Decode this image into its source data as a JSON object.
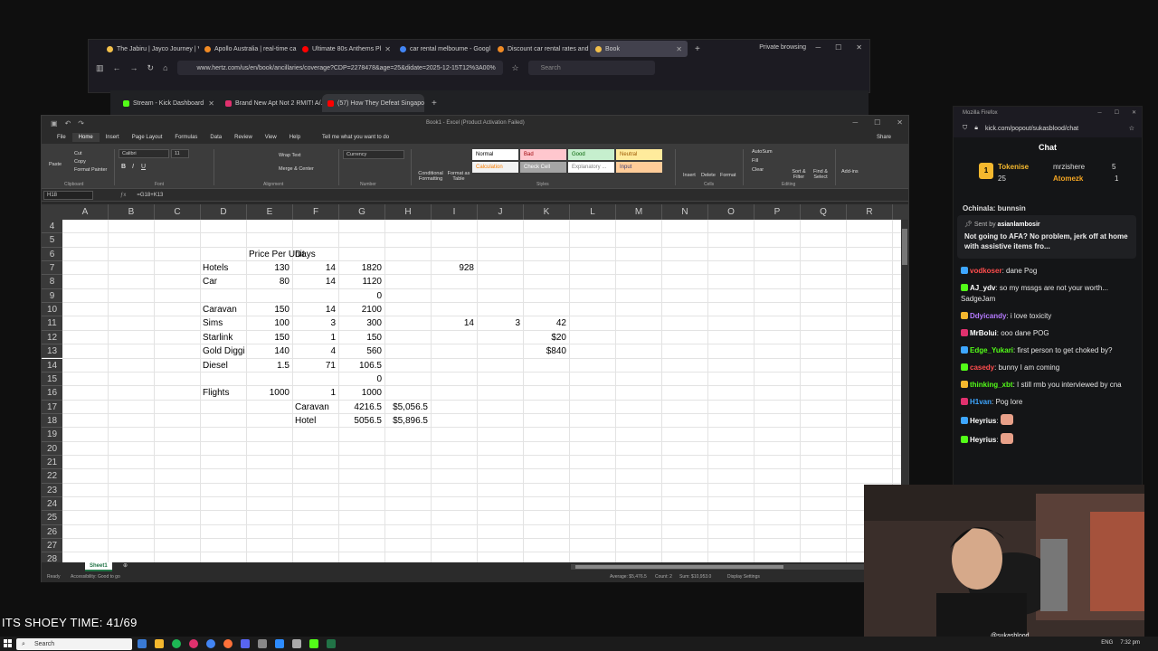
{
  "browser_back": {
    "tabs": [
      {
        "label": "The Jabiru | Jayco Journey | V",
        "color": "#f3c04a"
      },
      {
        "label": "Apollo Australia | real-time ca",
        "color": "#f08a24"
      },
      {
        "label": "Ultimate 80s Anthems Pl",
        "color": "#ff0000"
      },
      {
        "label": "car rental melbourne - Googl",
        "color": "#4285f4"
      },
      {
        "label": "Discount car rental rates and",
        "color": "#f08a24"
      },
      {
        "label": "Book",
        "color": "#f3c04a",
        "active": true
      }
    ],
    "private_label": "Private browsing",
    "url": "www.hertz.com/us/en/book/ancillaries/coverage?CDP=2278478&age=25&didate=2025-12-15T12%3A00%",
    "search_placeholder": "Search"
  },
  "browser_mid": {
    "tabs": [
      {
        "label": "Stream - Kick Dashboard",
        "color": "#53fc18"
      },
      {
        "label": "Brand New Apt Not 2 RMIT! A/...",
        "color": "#e0316e"
      },
      {
        "label": "(57) How They Defeat Singapo",
        "color": "#ff0000",
        "active": true
      }
    ]
  },
  "excel": {
    "title": "Book1 - Excel (Product Activation Failed)",
    "menu": [
      "File",
      "Home",
      "Insert",
      "Page Layout",
      "Formulas",
      "Data",
      "Review",
      "View",
      "Help"
    ],
    "tell_me": "Tell me what you want to do",
    "share": "Share",
    "ribbon": {
      "paste": "Paste",
      "cut": "Cut",
      "copy": "Copy",
      "format_painter": "Format Painter",
      "clipboard": "Clipboard",
      "font_name": "Calibri",
      "font_size": "11",
      "font": "Font",
      "wrap_text": "Wrap Text",
      "merge_center": "Merge & Center",
      "alignment": "Alignment",
      "number_format": "Currency",
      "number": "Number",
      "conditional": "Conditional Formatting",
      "format_as_table": "Format as Table",
      "styles": [
        {
          "label": "Normal",
          "bg": "#ffffff",
          "fg": "#000000"
        },
        {
          "label": "Bad",
          "bg": "#ffc7ce",
          "fg": "#9c0006"
        },
        {
          "label": "Good",
          "bg": "#c6efce",
          "fg": "#006100"
        },
        {
          "label": "Neutral",
          "bg": "#ffeb9c",
          "fg": "#9c5700"
        },
        {
          "label": "Calculation",
          "bg": "#f2f2f2",
          "fg": "#fa7d00"
        },
        {
          "label": "Check Cell",
          "bg": "#a5a5a5",
          "fg": "#ffffff"
        },
        {
          "label": "Explanatory ...",
          "bg": "#ffffff",
          "fg": "#7f7f7f"
        },
        {
          "label": "Input",
          "bg": "#ffcc99",
          "fg": "#3f3f76"
        }
      ],
      "styles_label": "Styles",
      "insert": "Insert",
      "delete": "Delete",
      "format": "Format",
      "cells": "Cells",
      "autosum": "AutoSum",
      "fill": "Fill",
      "clear": "Clear",
      "sort_filter": "Sort & Filter",
      "find_select": "Find & Select",
      "editing": "Editing",
      "addins": "Add-ins"
    },
    "name_box": "H18",
    "formula": "=G18+K13",
    "columns": [
      "A",
      "B",
      "C",
      "D",
      "E",
      "F",
      "G",
      "H",
      "I",
      "J",
      "K",
      "L",
      "M",
      "N",
      "O",
      "P",
      "Q",
      "R"
    ],
    "rows": [
      "4",
      "5",
      "6",
      "7",
      "8",
      "9",
      "10",
      "11",
      "12",
      "13",
      "14",
      "15",
      "16",
      "17",
      "18",
      "19",
      "20",
      "21",
      "22",
      "23",
      "24",
      "25",
      "26",
      "27",
      "28"
    ],
    "cells": [
      {
        "row": "6",
        "col": "E",
        "text": "Price Per Unit",
        "align": "left"
      },
      {
        "row": "6",
        "col": "F",
        "text": "Days",
        "align": "left"
      },
      {
        "row": "7",
        "col": "D",
        "text": "Hotels",
        "align": "left"
      },
      {
        "row": "7",
        "col": "E",
        "text": "130",
        "align": "right"
      },
      {
        "row": "7",
        "col": "F",
        "text": "14",
        "align": "right"
      },
      {
        "row": "7",
        "col": "G",
        "text": "1820",
        "align": "right"
      },
      {
        "row": "7",
        "col": "I",
        "text": "928",
        "align": "right"
      },
      {
        "row": "8",
        "col": "D",
        "text": "Car",
        "align": "left"
      },
      {
        "row": "8",
        "col": "E",
        "text": "80",
        "align": "right"
      },
      {
        "row": "8",
        "col": "F",
        "text": "14",
        "align": "right"
      },
      {
        "row": "8",
        "col": "G",
        "text": "1120",
        "align": "right"
      },
      {
        "row": "9",
        "col": "G",
        "text": "0",
        "align": "right"
      },
      {
        "row": "10",
        "col": "D",
        "text": "Caravan",
        "align": "left"
      },
      {
        "row": "10",
        "col": "E",
        "text": "150",
        "align": "right"
      },
      {
        "row": "10",
        "col": "F",
        "text": "14",
        "align": "right"
      },
      {
        "row": "10",
        "col": "G",
        "text": "2100",
        "align": "right"
      },
      {
        "row": "11",
        "col": "D",
        "text": "Sims",
        "align": "left"
      },
      {
        "row": "11",
        "col": "E",
        "text": "100",
        "align": "right"
      },
      {
        "row": "11",
        "col": "F",
        "text": "3",
        "align": "right"
      },
      {
        "row": "11",
        "col": "G",
        "text": "300",
        "align": "right"
      },
      {
        "row": "11",
        "col": "I",
        "text": "14",
        "align": "right"
      },
      {
        "row": "11",
        "col": "J",
        "text": "3",
        "align": "right"
      },
      {
        "row": "11",
        "col": "K",
        "text": "42",
        "align": "right"
      },
      {
        "row": "12",
        "col": "D",
        "text": "Starlink",
        "align": "left"
      },
      {
        "row": "12",
        "col": "E",
        "text": "150",
        "align": "right"
      },
      {
        "row": "12",
        "col": "F",
        "text": "1",
        "align": "right"
      },
      {
        "row": "12",
        "col": "G",
        "text": "150",
        "align": "right"
      },
      {
        "row": "12",
        "col": "K",
        "text": "$20",
        "align": "right"
      },
      {
        "row": "13",
        "col": "D",
        "text": "Gold Diggi",
        "align": "left"
      },
      {
        "row": "13",
        "col": "E",
        "text": "140",
        "align": "right"
      },
      {
        "row": "13",
        "col": "F",
        "text": "4",
        "align": "right"
      },
      {
        "row": "13",
        "col": "G",
        "text": "560",
        "align": "right"
      },
      {
        "row": "13",
        "col": "K",
        "text": "$840",
        "align": "right"
      },
      {
        "row": "14",
        "col": "D",
        "text": "Diesel",
        "align": "left"
      },
      {
        "row": "14",
        "col": "E",
        "text": "1.5",
        "align": "right"
      },
      {
        "row": "14",
        "col": "F",
        "text": "71",
        "align": "right"
      },
      {
        "row": "14",
        "col": "G",
        "text": "106.5",
        "align": "right"
      },
      {
        "row": "15",
        "col": "G",
        "text": "0",
        "align": "right"
      },
      {
        "row": "16",
        "col": "D",
        "text": "Flights",
        "align": "left"
      },
      {
        "row": "16",
        "col": "E",
        "text": "1000",
        "align": "right"
      },
      {
        "row": "16",
        "col": "F",
        "text": "1",
        "align": "right"
      },
      {
        "row": "16",
        "col": "G",
        "text": "1000",
        "align": "right"
      },
      {
        "row": "17",
        "col": "F",
        "text": "Caravan",
        "align": "left"
      },
      {
        "row": "17",
        "col": "G",
        "text": "4216.5",
        "align": "right"
      },
      {
        "row": "17",
        "col": "H",
        "text": "$5,056.5",
        "align": "right"
      },
      {
        "row": "18",
        "col": "F",
        "text": "Hotel",
        "align": "left"
      },
      {
        "row": "18",
        "col": "G",
        "text": "5056.5",
        "align": "right"
      },
      {
        "row": "18",
        "col": "H",
        "text": "$5,896.5",
        "align": "right"
      }
    ],
    "sheet_tab": "Sheet1",
    "status_ready": "Ready",
    "status_accessibility": "Accessibility: Good to go",
    "status_average": "Average: $5,476.5",
    "status_count": "Count: 2",
    "status_sum": "Sum: $10,953.0",
    "status_display": "Display Settings"
  },
  "chat": {
    "window_title": "Mozilla Firefox",
    "url": "kick.com/popout/sukasblood/chat",
    "header": "Chat",
    "leaders": [
      {
        "name": "Tokenise",
        "count": "25",
        "color": "#f5b82e"
      },
      {
        "name": "mrzishere",
        "count": "5",
        "color": "#ffffff"
      },
      {
        "name": "Atomezk",
        "count": "1",
        "color": "#f5a623"
      }
    ],
    "partial_top": "Ochinala: bunnsin",
    "pinned_by_label": "Sent by",
    "pinned_by": "asianlambosir",
    "pinned_text": "Not going to AFA? No problem, jerk off at home with assistive items fro...",
    "messages": [
      {
        "user": "vodkoser",
        "user_color": "#ff4d4d",
        "text": "dane Pog"
      },
      {
        "user": "AJ_ydv",
        "user_color": "#ffffff",
        "text": "so my mssgs are not your worth... SadgeJam"
      },
      {
        "user": "Ddyicandy",
        "user_color": "#b57aff",
        "text": "i love toxicity"
      },
      {
        "user": "MrBolui",
        "user_color": "#ffffff",
        "text": "ooo dane POG"
      },
      {
        "user": "Edge_Yukari",
        "user_color": "#53fc18",
        "text": "first person to get choked by?"
      },
      {
        "user": "casedy",
        "user_color": "#ff4d4d",
        "text": "bunny I am coming"
      },
      {
        "user": "thinking_xbt",
        "user_color": "#53fc18",
        "text": "I still rmb you interviewed by cna"
      },
      {
        "user": "H1van",
        "user_color": "#3ea6ff",
        "text": "Pog lore"
      },
      {
        "user": "Heyrius",
        "user_color": "#ffffff",
        "text": ""
      },
      {
        "user": "Heyrius",
        "user_color": "#ffffff",
        "text": ""
      }
    ]
  },
  "cam": {
    "handle": "@sukasblood"
  },
  "overlay_text": "ITS SHOEY TIME: 41/69",
  "taskbar": {
    "search_placeholder": "Search",
    "lang": "ENG",
    "time": "7:32 pm"
  }
}
